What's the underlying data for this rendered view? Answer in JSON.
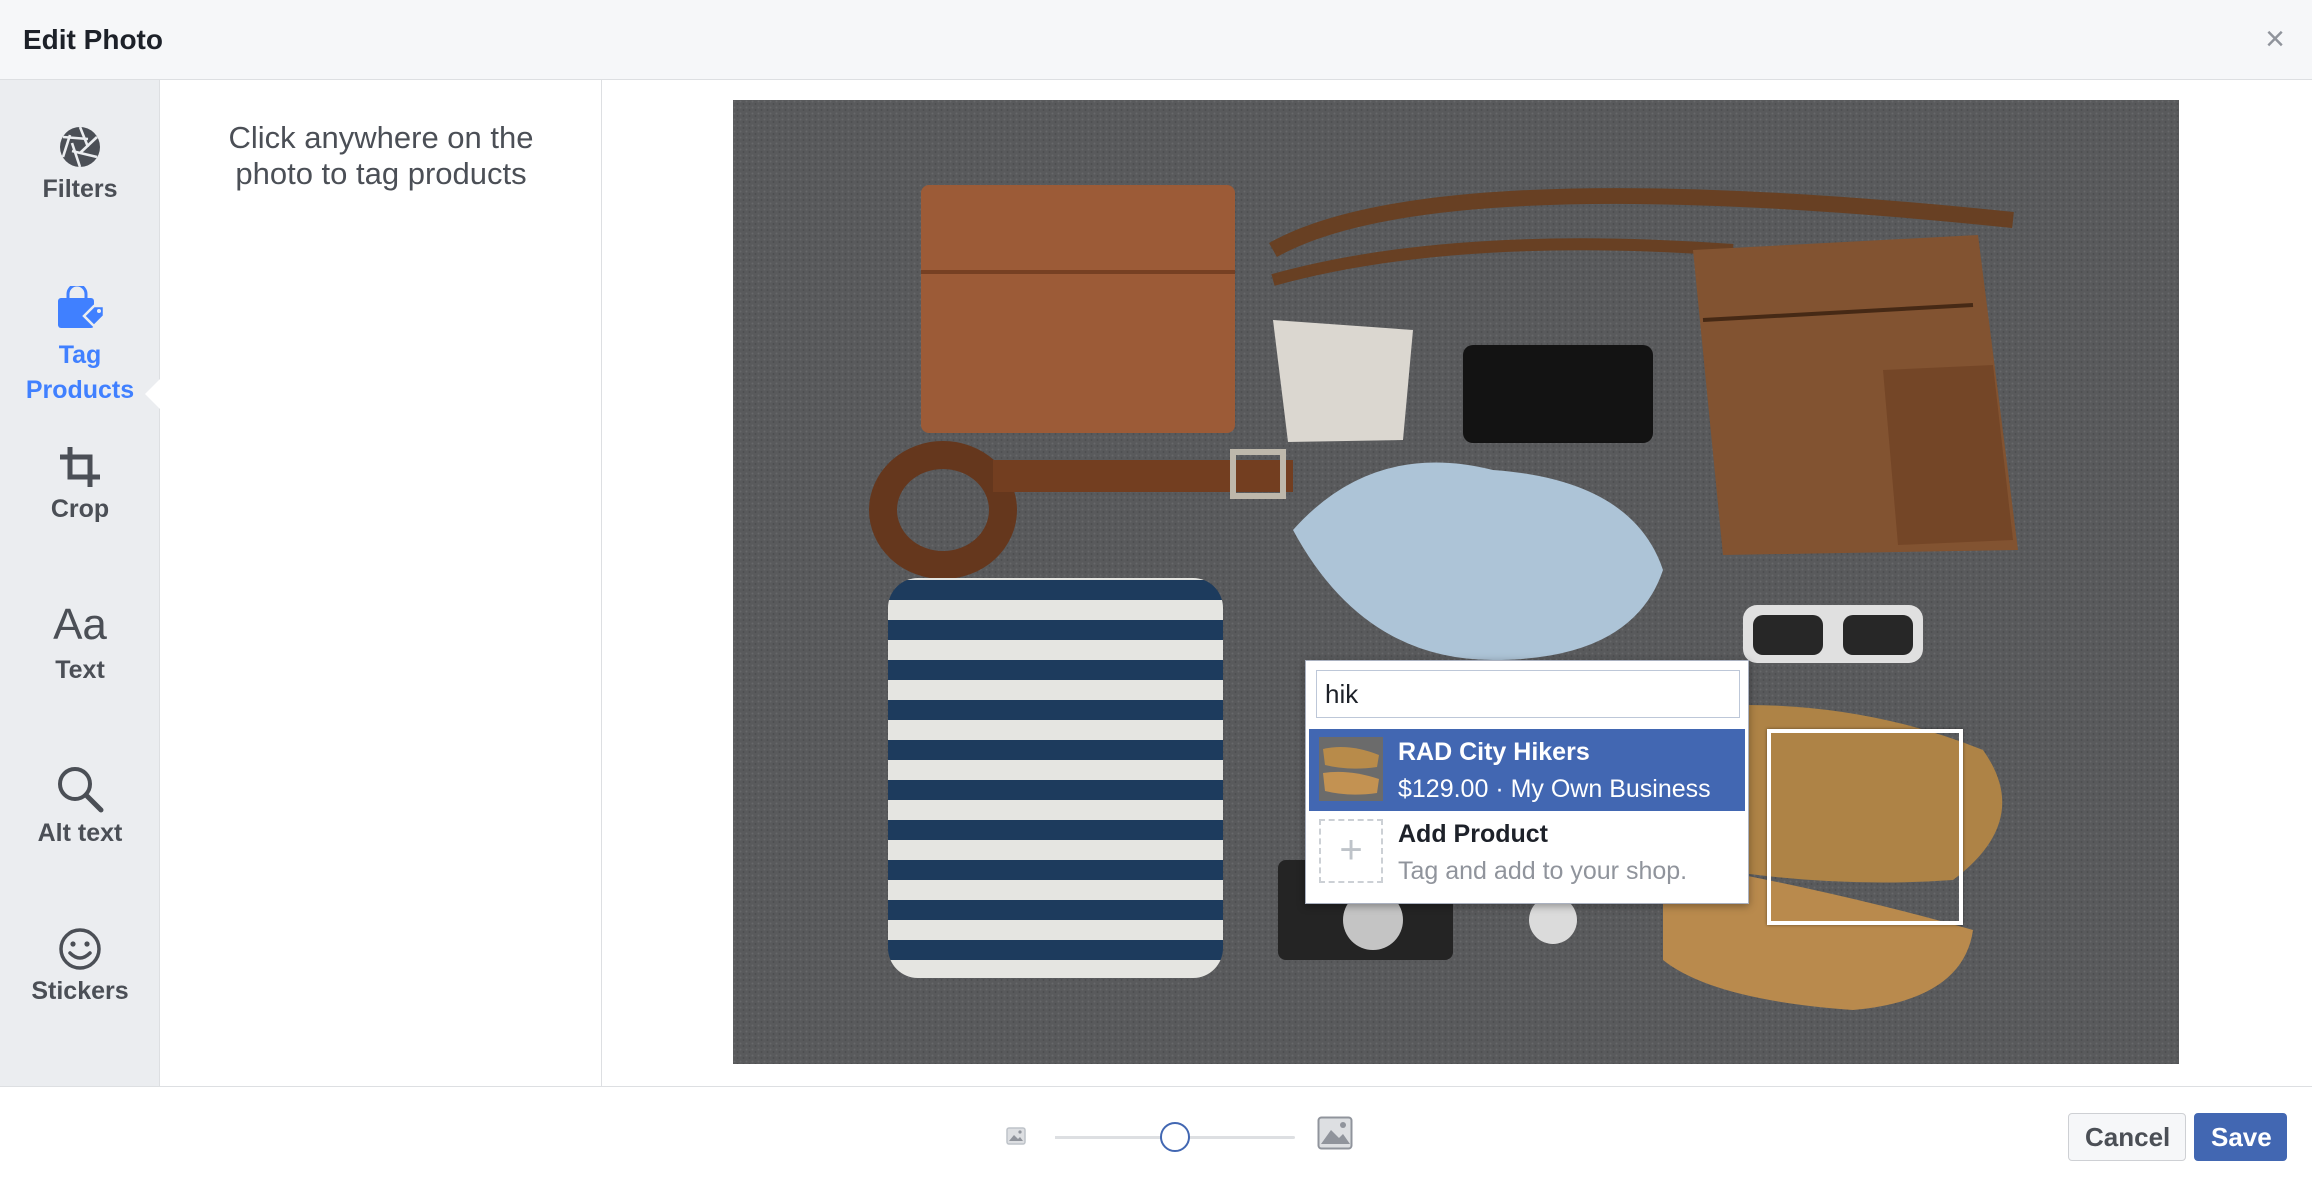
{
  "dialog": {
    "title": "Edit Photo",
    "close_icon": "close-icon"
  },
  "tools": [
    {
      "label": "Filters",
      "icon": "aperture-icon",
      "active": false
    },
    {
      "label": "Tag\nProducts",
      "icon": "shopping-bag-tag-icon",
      "active": true
    },
    {
      "label": "Crop",
      "icon": "crop-icon",
      "active": false
    },
    {
      "label": "Text",
      "icon": "text-aa-icon",
      "active": false
    },
    {
      "label": "Alt text",
      "icon": "magnifier-icon",
      "active": false
    },
    {
      "label": "Stickers",
      "icon": "smiley-icon",
      "active": false
    }
  ],
  "panel": {
    "instruction": "Click anywhere on the photo to tag products"
  },
  "tag_search": {
    "query": "hik",
    "results": [
      {
        "title": "RAD City Hikers",
        "subtitle": "$129.00 · My Own Business",
        "selected": true
      },
      {
        "title": "Add Product",
        "subtitle": "Tag and add to your shop.",
        "selected": false
      }
    ]
  },
  "footer": {
    "zoom_level": 0.5,
    "cancel_label": "Cancel",
    "save_label": "Save"
  },
  "colors": {
    "accent": "#4267b2",
    "active_tool": "#4080ff"
  }
}
